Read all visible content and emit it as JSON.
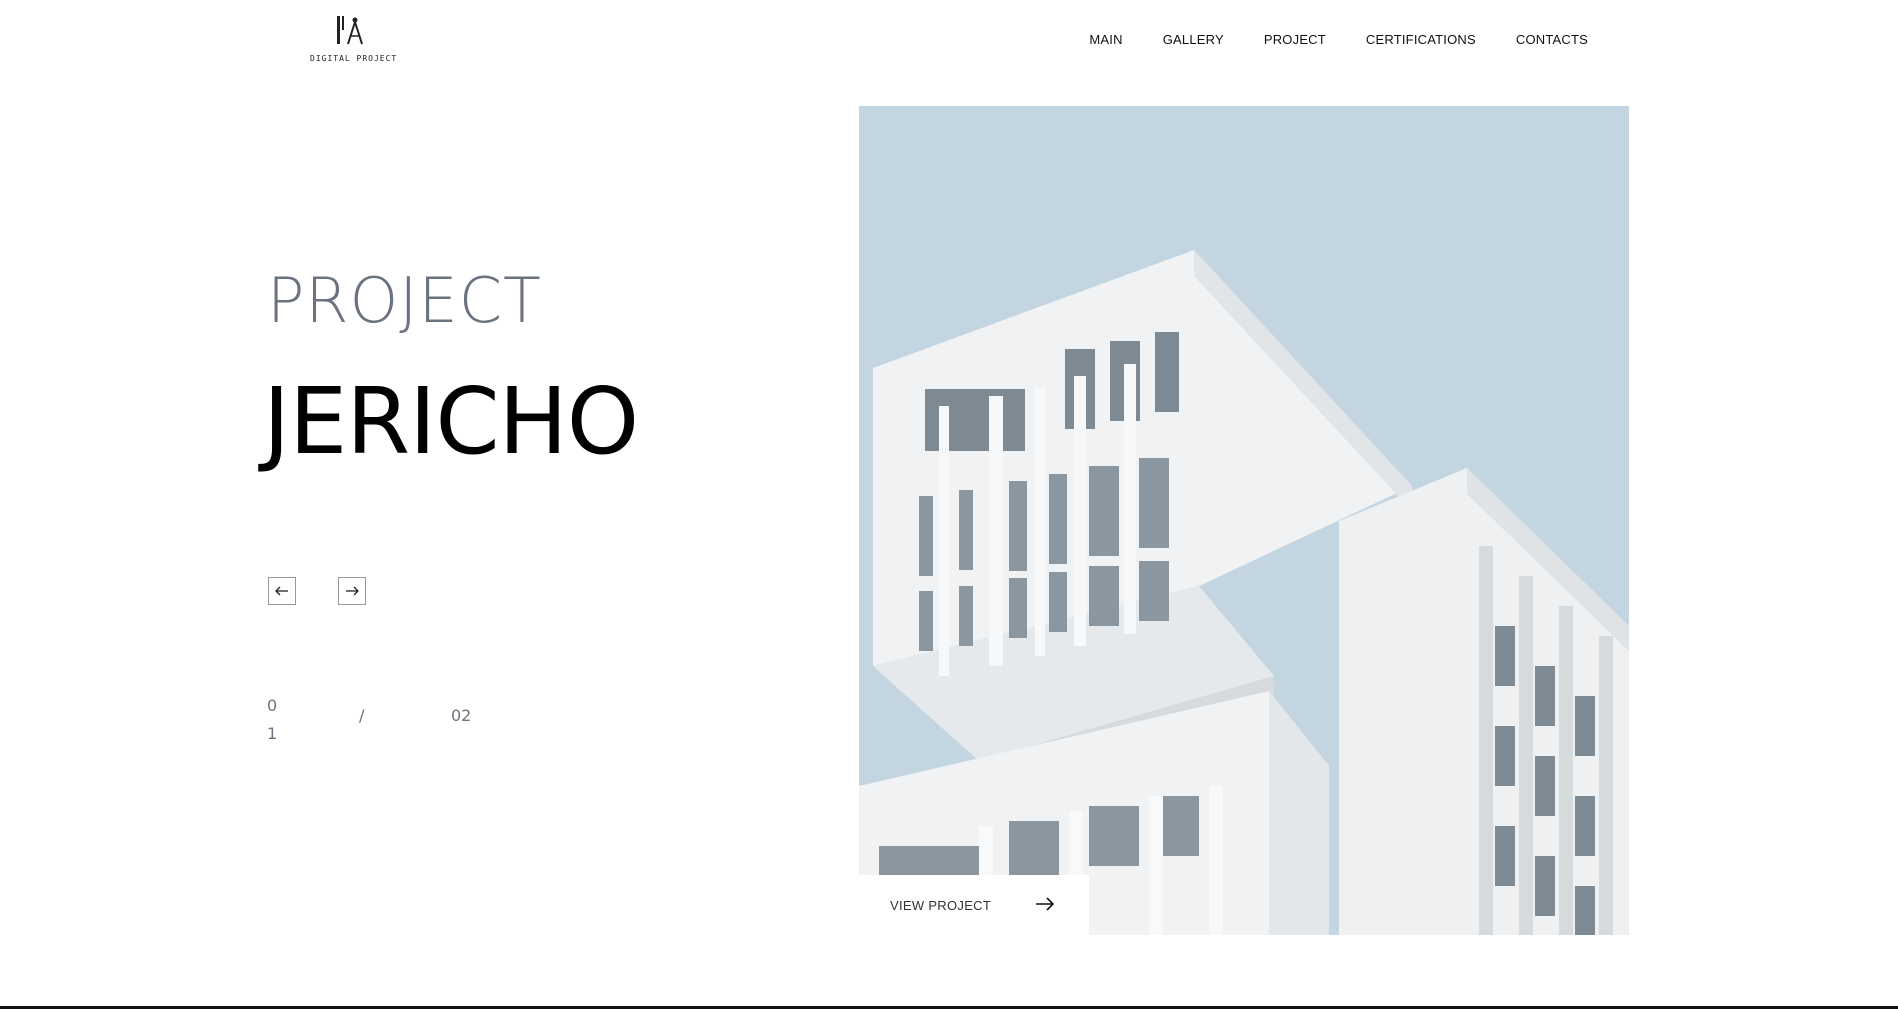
{
  "logo": {
    "text": "DIGITAL PROJECT",
    "icon": "compass-logo-icon"
  },
  "nav": {
    "items": [
      {
        "label": "MAIN"
      },
      {
        "label": "GALLERY"
      },
      {
        "label": "PROJECT"
      },
      {
        "label": "CERTIFICATIONS"
      },
      {
        "label": "CONTACTS"
      }
    ]
  },
  "hero": {
    "eyebrow": "PROJECT",
    "title": "JERICHO",
    "prev_icon": "arrow-left-icon",
    "next_icon": "arrow-right-icon",
    "counter": {
      "current": "01",
      "separator": "/",
      "total": "02"
    },
    "image": {
      "subject": "white-building-photo",
      "sky_color": "#c2d5e0",
      "building_color": "#eef0f1"
    },
    "view_project": {
      "label": "VIEW PROJECT",
      "icon": "arrow-right-icon"
    }
  }
}
